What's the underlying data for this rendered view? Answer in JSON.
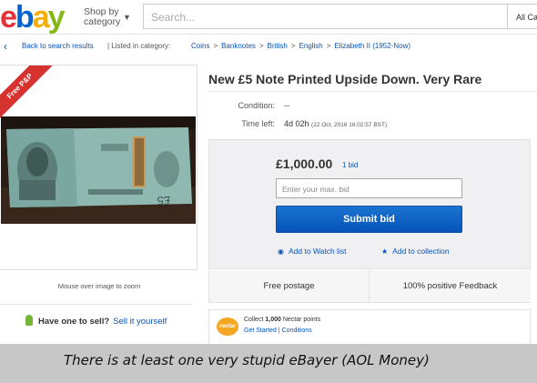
{
  "header": {
    "logo_letters": [
      {
        "char": "e",
        "color": "#e53238"
      },
      {
        "char": "b",
        "color": "#0064d2"
      },
      {
        "char": "a",
        "color": "#f5af02"
      },
      {
        "char": "y",
        "color": "#86b817"
      }
    ],
    "shop_by_line1": "Shop by",
    "shop_by_line2": "category",
    "search_placeholder": "Search...",
    "all_categories": "All Ca"
  },
  "breadcrumb": {
    "back_label": "Back to search results",
    "listed_label": "| Listed in category:",
    "categories": [
      "Coins",
      "Banknotes",
      "British",
      "English",
      "Elizabeth II (1952-Now)"
    ],
    "separator": ">"
  },
  "image_panel": {
    "ribbon": "Free P&P",
    "zoom_hint": "Mouse over image to zoom"
  },
  "sell": {
    "question": "Have one to sell?",
    "link": "Sell it yourself"
  },
  "listing": {
    "title": "New £5 Note Printed Upside Down. Very Rare",
    "condition_label": "Condition:",
    "condition_value": "--",
    "time_left_label": "Time left:",
    "time_left_value": "4d 02h",
    "time_left_detail": "(22 Oct, 2016   16:02:57 BST)"
  },
  "bid": {
    "price": "£1,000.00",
    "bid_count": "1 bid",
    "max_bid_placeholder": "Enter your max. bid",
    "submit_label": "Submit bid",
    "watch_label": "Add to Watch list",
    "collection_label": "Add to collection"
  },
  "info": {
    "postage": "Free postage",
    "feedback": "100% positive Feedback"
  },
  "nectar": {
    "logo_text": "nectar",
    "collect_prefix": "Collect",
    "points": "1,000",
    "collect_suffix": "Nectar points",
    "get_started": "Get Started",
    "conditions": "Conditions",
    "separator": "|"
  },
  "caption": {
    "text": "There is at least one very stupid eBayer (AOL Money)"
  },
  "colors": {
    "link": "#0654ba",
    "button": "#0654ba",
    "ribbon": "#d6332e"
  }
}
